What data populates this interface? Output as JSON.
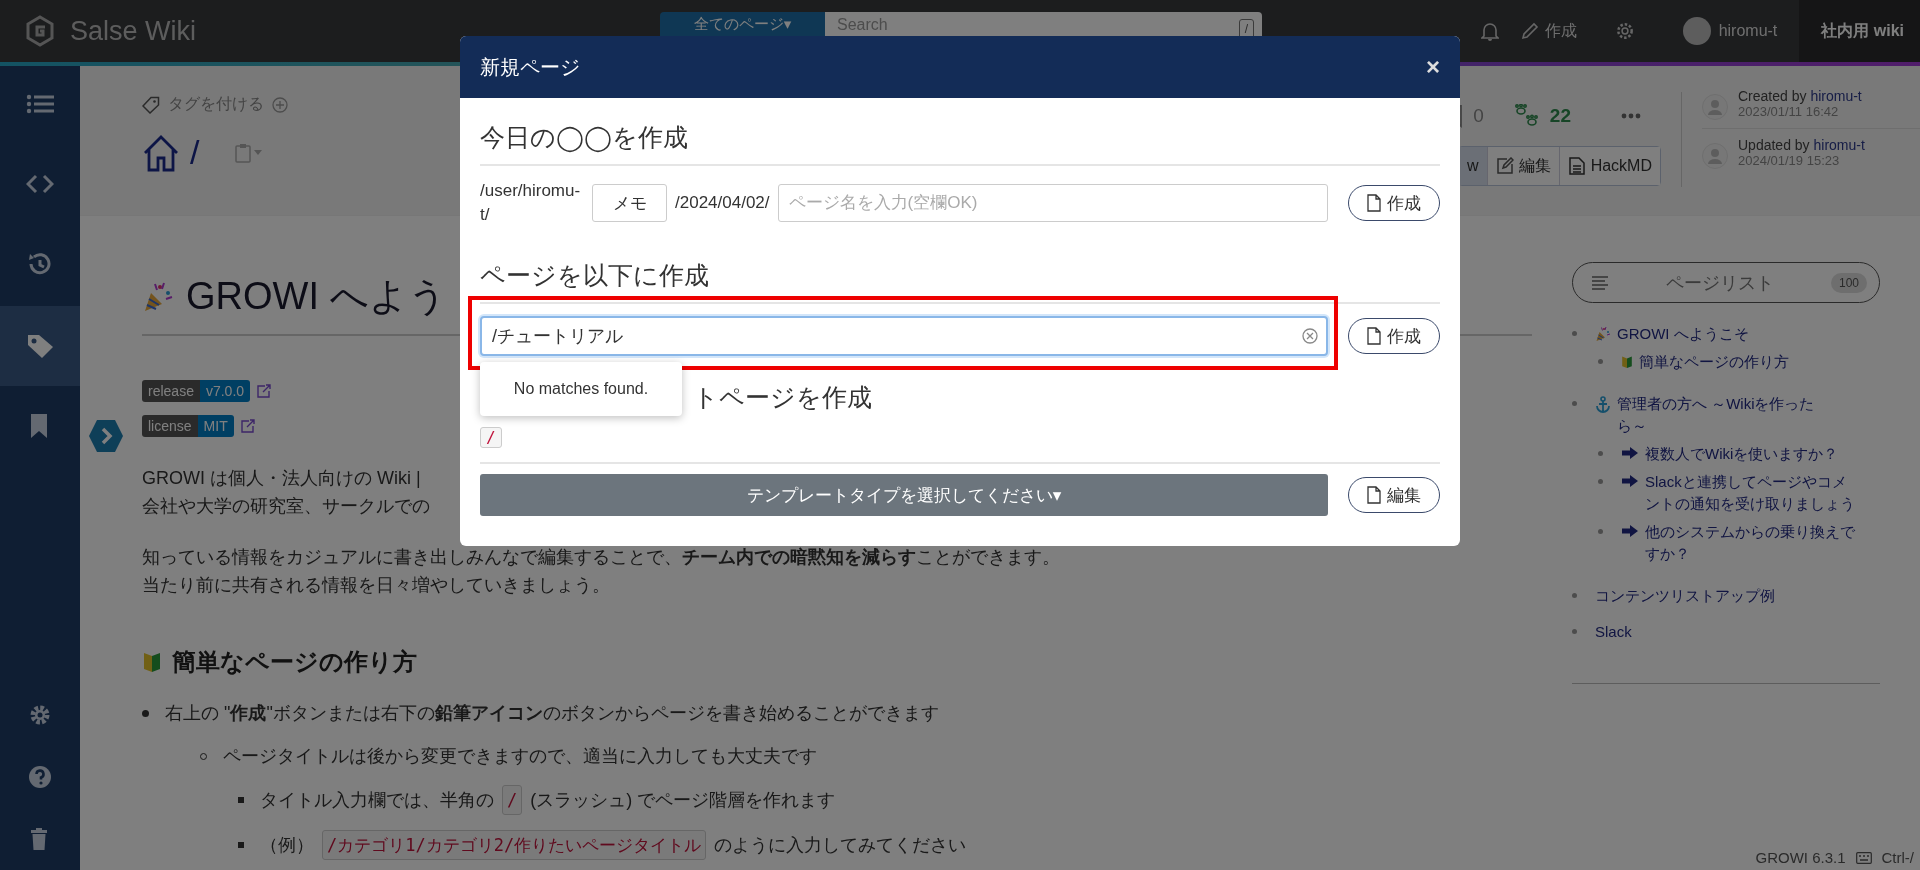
{
  "topbar": {
    "brand": "Salse Wiki",
    "search": {
      "scope": "全てのページ▾",
      "placeholder": "Search",
      "key": "/"
    },
    "create": "作成",
    "user": "hiromu-t",
    "wiki": "社内用 wiki"
  },
  "sidebar": {
    "items": [
      {
        "kind": "list",
        "selected": false
      },
      {
        "kind": "code",
        "selected": false
      },
      {
        "kind": "history",
        "selected": false
      },
      {
        "kind": "tag",
        "selected": true
      },
      {
        "kind": "bookmark",
        "selected": false
      }
    ],
    "bottom": [
      {
        "kind": "gear"
      },
      {
        "kind": "help"
      },
      {
        "kind": "trash"
      }
    ]
  },
  "page_header": {
    "tag_link": "タグを付ける",
    "path": "/",
    "bookmarks": "0",
    "likes": "22",
    "view_buttons": [
      {
        "kind": "view",
        "label": "w",
        "selected": true
      },
      {
        "kind": "edit",
        "label": "編集",
        "selected": false
      },
      {
        "kind": "hackmd",
        "label": "HackMD",
        "selected": false
      }
    ],
    "authors": [
      {
        "action": "Created by",
        "user": "hiromu-t",
        "date": "2023/01/11 16:42"
      },
      {
        "action": "Updated by",
        "user": "hiromu-t",
        "date": "2024/01/19 15:23"
      }
    ]
  },
  "content": {
    "title": "GROWI へよう",
    "badges": [
      {
        "label": "release",
        "value": "v7.0.0"
      },
      {
        "label": "license",
        "value": "MIT"
      }
    ],
    "paragraphs": [
      [
        "GROWI は個人・法人向けの Wiki |",
        "会社や大学の研究室、サークルでの"
      ],
      [
        "知っている情報をカジュアルに書き出しみんなで編集することで、**チーム内での暗黙知を減らす**ことができます。",
        "当たり前に共有される情報を日々増やしていきましょう。"
      ]
    ],
    "section_title": "簡単なページの作り方",
    "items": [
      {
        "segments": [
          {
            "kind": "text",
            "text": "右上の \"**作成**\"ボタンまたは右下の**鉛筆アイコン**のボタンからページを書き始めることができます"
          }
        ],
        "children": [
          {
            "segments": [
              {
                "kind": "text",
                "text": "ページタイトルは後から変更できますので、適当に入力しても大丈夫です"
              }
            ],
            "children": [
              {
                "segments": [
                  {
                    "kind": "text",
                    "text": "タイトル入力欄では、半角の"
                  },
                  {
                    "kind": "code",
                    "text": "/"
                  },
                  {
                    "kind": "text",
                    "text": "(スラッシュ) でページ階層を作れます"
                  }
                ]
              },
              {
                "segments": [
                  {
                    "kind": "text",
                    "text": "（例）"
                  },
                  {
                    "kind": "code",
                    "text": "/カテゴリ1/カテゴリ2/作りたいページタイトル"
                  },
                  {
                    "kind": "text",
                    "text": "のように入力してみてください"
                  }
                ]
              }
            ]
          }
        ]
      }
    ]
  },
  "page_list": {
    "label": "ページリスト",
    "count": "100",
    "items": [
      {
        "kind": "party",
        "text": "GROWI へようこそ",
        "children": [
          {
            "kind": "beginner",
            "text": "簡単なページの作り方"
          }
        ]
      },
      {
        "kind": "anchor",
        "text": "管理者の方へ ～Wikiを作ったら～",
        "children": [
          {
            "kind": "arrow",
            "text": "複数人でWikiを使いますか？"
          },
          {
            "kind": "arrow",
            "text": "Slackと連携してページやコメントの通知を受け取りましょう"
          },
          {
            "kind": "arrow",
            "text": "他のシステムからの乗り換えですか？"
          }
        ]
      },
      {
        "kind": "plain",
        "text": "コンテンツリストアップ例"
      },
      {
        "kind": "plain",
        "text": "Slack"
      }
    ]
  },
  "footer": {
    "version": "GROWI 6.3.1",
    "shortcut": "Ctrl-/"
  },
  "modal": {
    "title": "新規ページ",
    "close": "×",
    "today": {
      "heading": "今日の◯◯を作成",
      "prefix": "/user/hiromu-t/",
      "memo": "メモ",
      "date": "/2024/04/02/",
      "placeholder": "ページ名を入力(空欄OK)",
      "button": "作成"
    },
    "under": {
      "heading": "ページを以下に作成",
      "value": "/チュートリアル",
      "button": "作成",
      "suggestion": "No matches found."
    },
    "template": {
      "heading": "トページを作成",
      "path": "/",
      "select": "テンプレートタイプを選択してください▾",
      "button": "編集"
    }
  }
}
